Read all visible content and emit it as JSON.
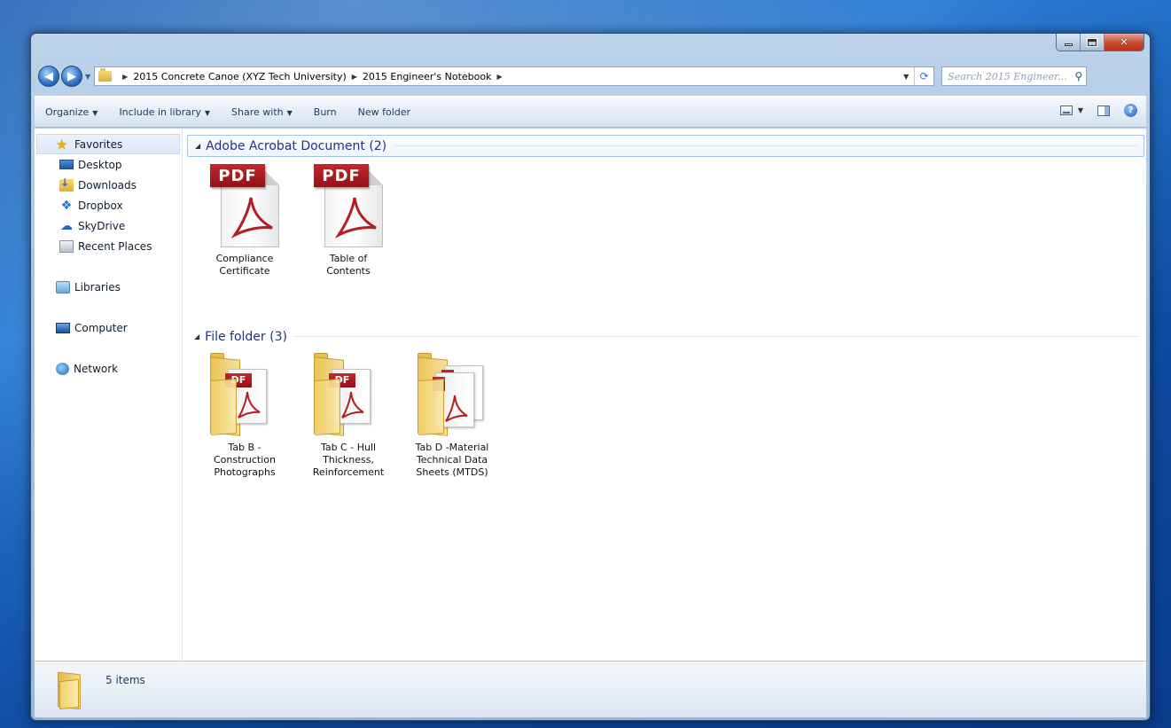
{
  "window": {
    "caption_buttons": [
      "minimize",
      "maximize",
      "close"
    ]
  },
  "addressbar": {
    "breadcrumbs": [
      "2015 Concrete Canoe (XYZ Tech University)",
      "2015 Engineer's Notebook"
    ],
    "search_placeholder": "Search 2015 Engineer..."
  },
  "toolbar": {
    "organize": "Organize",
    "include_in_library": "Include in library",
    "share_with": "Share with",
    "burn": "Burn",
    "new_folder": "New folder"
  },
  "navpane": {
    "favorites": "Favorites",
    "favorite_items": [
      "Desktop",
      "Downloads",
      "Dropbox",
      "SkyDrive",
      "Recent Places"
    ],
    "libraries": "Libraries",
    "computer": "Computer",
    "network": "Network"
  },
  "content": {
    "groups": [
      {
        "header": "Adobe Acrobat Document (2)",
        "items": [
          {
            "label_lines": [
              "Compliance",
              "Certificate"
            ],
            "icon": "pdf-icon"
          },
          {
            "label_lines": [
              "Table of",
              "Contents"
            ],
            "icon": "pdf-icon"
          }
        ]
      },
      {
        "header": "File folder (3)",
        "items": [
          {
            "label_lines": [
              "Tab B -",
              "Construction",
              "Photographs"
            ],
            "icon": "folder-pdf-icon"
          },
          {
            "label_lines": [
              "Tab C - Hull",
              "Thickness,",
              "Reinforcement"
            ],
            "icon": "folder-pdf-icon"
          },
          {
            "label_lines": [
              "Tab D -Material",
              "Technical Data",
              "Sheets (MTDS)"
            ],
            "icon": "folder-multi-pdf-icon"
          }
        ]
      }
    ],
    "pdf_badge_text": "PDF",
    "folder_badge_text": "DF"
  },
  "statusbar": {
    "item_count": "5 items"
  },
  "colors": {
    "accent_blue": "#1e3287",
    "pdf_red": "#b51d24",
    "folder_yellow": "#f1cf66"
  }
}
